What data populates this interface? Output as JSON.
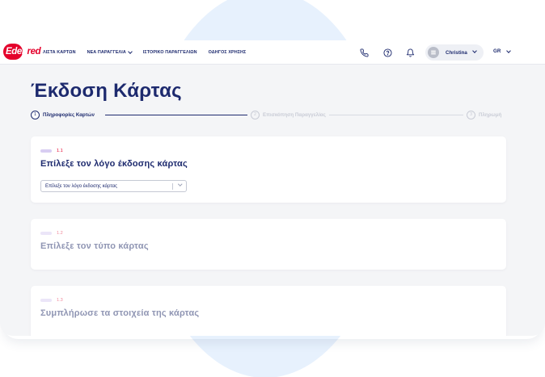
{
  "brand": {
    "logo_text_first": "Eden",
    "logo_text_rest": "red",
    "accent": "#e4002b",
    "navy": "#1d2a6e"
  },
  "nav": {
    "items": [
      {
        "label": "ΛΙΣΤΑ ΚΑΡΤΩΝ",
        "dropdown": false
      },
      {
        "label": "ΝΕΑ ΠΑΡΑΓΓΕΛΙΑ",
        "dropdown": true
      },
      {
        "label": "ΙΣΤΟΡΙΚΟ ΠΑΡΑΓΓΕΛΙΩΝ",
        "dropdown": false
      },
      {
        "label": "ΟΔΗΓΟΣ ΧΡΗΣΗΣ",
        "dropdown": false
      }
    ]
  },
  "header_icons": [
    "phone-icon",
    "help-icon",
    "bell-icon"
  ],
  "user": {
    "name": "Christina"
  },
  "language": {
    "selected": "GR"
  },
  "page": {
    "title": "Έκδοση Κάρτας"
  },
  "stepper": {
    "steps": [
      {
        "number": "1",
        "label": "Πληροφορίες Καρτών",
        "active": true
      },
      {
        "number": "2",
        "label": "Επισκόπηση Παραγγελίας",
        "active": false
      },
      {
        "number": "3",
        "label": "Πληρωμή",
        "active": false
      }
    ]
  },
  "sections": [
    {
      "number": "1.1",
      "title": "Επίλεξε τον λόγο έκδοσης κάρτας",
      "active": true,
      "select": {
        "placeholder": "Επίλεξε τον λόγο έκδοσης κάρτας"
      }
    },
    {
      "number": "1.2",
      "title": "Επίλεξε τον τύπο κάρτας",
      "active": false
    },
    {
      "number": "1.3",
      "title": "Συμπλήρωσε τα στοιχεία της κάρτας",
      "active": false
    }
  ]
}
